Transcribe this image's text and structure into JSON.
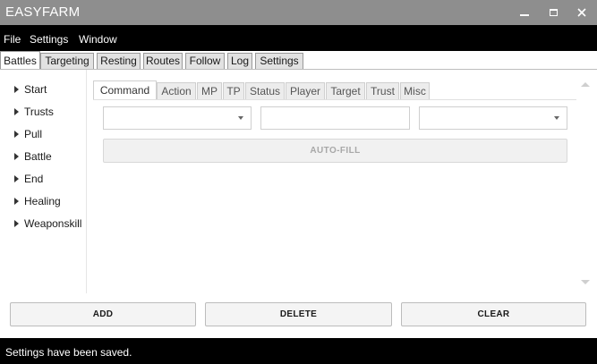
{
  "window": {
    "title": "EASYFARM",
    "minimize_icon": "minimize-icon",
    "maximize_icon": "maximize-icon",
    "close_icon": "close-icon"
  },
  "menu": [
    "File",
    "Settings",
    "Window"
  ],
  "main_tabs": [
    "Battles",
    "Targeting",
    "Resting",
    "Routes",
    "Follow",
    "Log",
    "Settings"
  ],
  "active_main_tab": "Battles",
  "tree": [
    "Start",
    "Trusts",
    "Pull",
    "Battle",
    "End",
    "Healing",
    "Weaponskill"
  ],
  "sub_tabs": [
    "Command",
    "Action",
    "MP",
    "TP",
    "Status",
    "Player",
    "Target",
    "Trust",
    "Misc"
  ],
  "active_sub_tab": "Command",
  "form": {
    "combo1_value": "",
    "text_value": "",
    "combo2_value": "",
    "autofill_label": "AUTO-FILL"
  },
  "buttons": {
    "add": "ADD",
    "delete": "DELETE",
    "clear": "CLEAR"
  },
  "status": "Settings have been saved.",
  "colors": {
    "titlebar": "#8e8e8e",
    "menubar": "#000000",
    "statusbar": "#000000"
  }
}
